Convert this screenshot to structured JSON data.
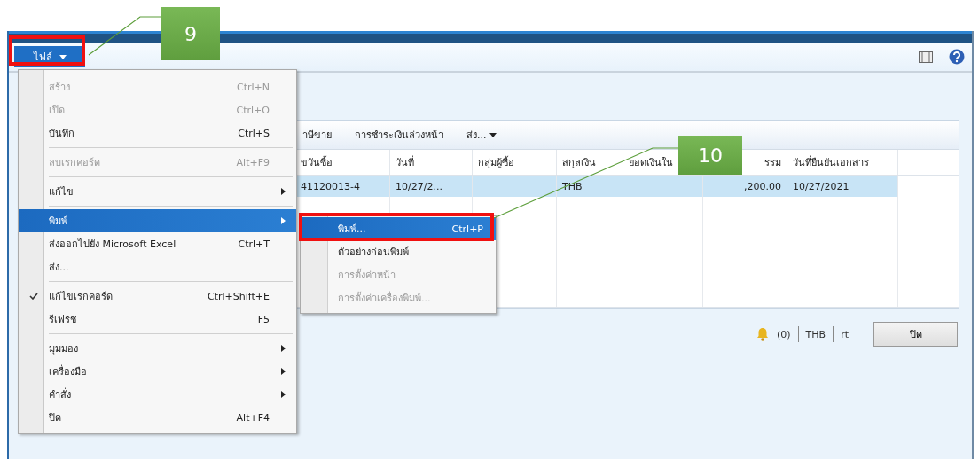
{
  "window": {
    "file_button": {
      "label": "ไฟล์"
    }
  },
  "file_menu": {
    "items": [
      {
        "kind": "item",
        "label": "สร้าง",
        "shortcut": "Ctrl+N",
        "disabled": true,
        "checked": false,
        "submenu": false,
        "selected": false
      },
      {
        "kind": "item",
        "label": "เปิด",
        "shortcut": "Ctrl+O",
        "disabled": true,
        "checked": false,
        "submenu": false,
        "selected": false
      },
      {
        "kind": "item",
        "label": "บันทึก",
        "shortcut": "Ctrl+S",
        "disabled": false,
        "checked": false,
        "submenu": false,
        "selected": false
      },
      {
        "kind": "separator"
      },
      {
        "kind": "item",
        "label": "ลบเรกคอร์ด",
        "shortcut": "Alt+F9",
        "disabled": true,
        "checked": false,
        "submenu": false,
        "selected": false
      },
      {
        "kind": "separator"
      },
      {
        "kind": "item",
        "label": "แก้ไข",
        "disabled": false,
        "checked": false,
        "submenu": true,
        "selected": false
      },
      {
        "kind": "separator"
      },
      {
        "kind": "item",
        "label": "พิมพ์",
        "disabled": false,
        "checked": false,
        "submenu": true,
        "selected": true
      },
      {
        "kind": "item",
        "label": "ส่งออกไปยัง Microsoft Excel",
        "shortcut": "Ctrl+T",
        "disabled": false,
        "checked": false,
        "submenu": false,
        "selected": false
      },
      {
        "kind": "item",
        "label": "ส่ง...",
        "disabled": false,
        "checked": false,
        "submenu": false,
        "selected": false
      },
      {
        "kind": "separator"
      },
      {
        "kind": "item",
        "label": "แก้ไขเรกคอร์ด",
        "shortcut": "Ctrl+Shift+E",
        "disabled": false,
        "checked": true,
        "submenu": false,
        "selected": false
      },
      {
        "kind": "item",
        "label": "รีเฟรช",
        "shortcut": "F5",
        "disabled": false,
        "checked": false,
        "submenu": false,
        "selected": false
      },
      {
        "kind": "separator"
      },
      {
        "kind": "item",
        "label": "มุมมอง",
        "disabled": false,
        "checked": false,
        "submenu": true,
        "selected": false
      },
      {
        "kind": "item",
        "label": "เครื่องมือ",
        "disabled": false,
        "checked": false,
        "submenu": true,
        "selected": false
      },
      {
        "kind": "item",
        "label": "คำสั่ง",
        "disabled": false,
        "checked": false,
        "submenu": true,
        "selected": false
      },
      {
        "kind": "item",
        "label": "ปิด",
        "shortcut": "Alt+F4",
        "disabled": false,
        "checked": false,
        "submenu": false,
        "selected": false
      }
    ]
  },
  "print_submenu": {
    "items": [
      {
        "label": "พิมพ์...",
        "shortcut": "Ctrl+P",
        "disabled": false,
        "selected": true
      },
      {
        "label": "ตัวอย่างก่อนพิมพ์",
        "disabled": false,
        "selected": false
      },
      {
        "label": "การตั้งค่าหน้า",
        "disabled": true,
        "selected": false
      },
      {
        "label": "การตั้งค่าเครื่องพิมพ์...",
        "disabled": true,
        "selected": false
      }
    ]
  },
  "toolbar": {
    "actions": [
      {
        "label": "าษีขาย",
        "dropdown": false
      },
      {
        "label": "การชำระเงินล่วงหน้า",
        "dropdown": false
      },
      {
        "label": "ส่ง...",
        "dropdown": true
      }
    ]
  },
  "table": {
    "columns": [
      "ขวันซื้อ",
      "วันที่",
      "กลุ่มผู้ซื้อ",
      "สกุลเงิน",
      "ยอดเงินใน",
      "รรม",
      "วันที่ยืนยันเอกสาร"
    ],
    "rows": [
      {
        "selected": true,
        "cells": [
          "41120013-4",
          "10/27/2...",
          null,
          "THB",
          null,
          ",200.00",
          "10/27/2021"
        ]
      }
    ]
  },
  "status_bar": {
    "notifications": "(0)",
    "currency": "THB",
    "user": "rt",
    "close_button": "ปิด"
  },
  "callouts": [
    {
      "number": "9"
    },
    {
      "number": "10"
    }
  ]
}
